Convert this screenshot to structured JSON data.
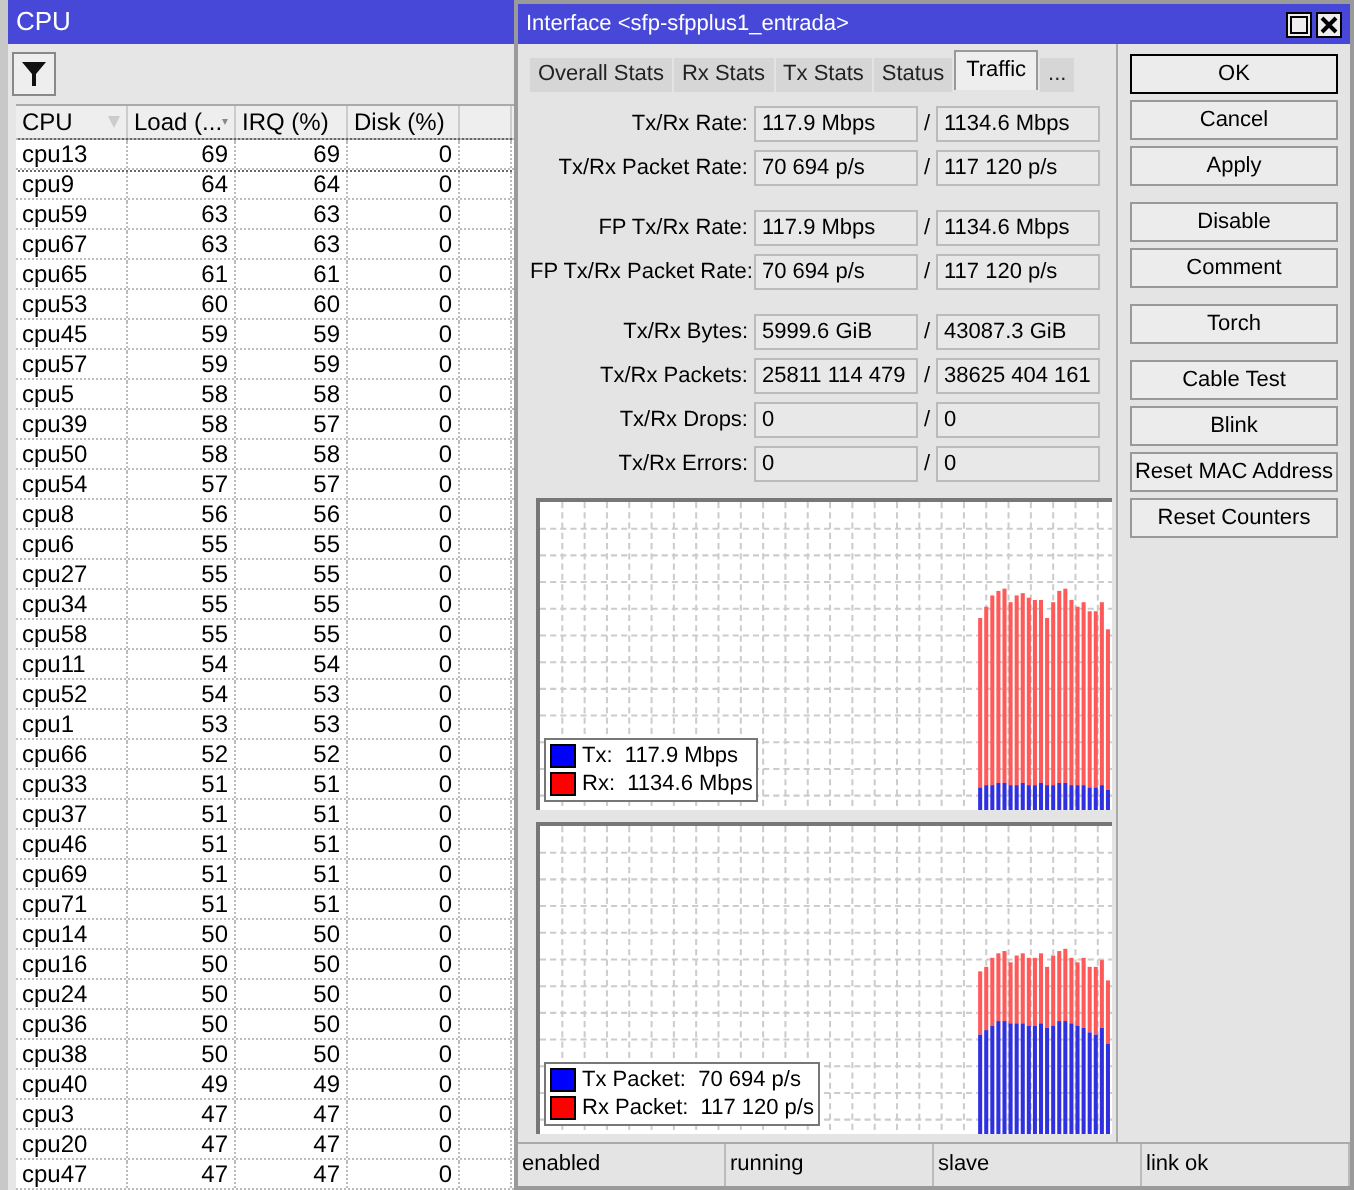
{
  "cpu_window": {
    "title": "CPU",
    "columns": [
      "CPU",
      "Load (...",
      "IRQ (%)",
      "Disk (%)"
    ],
    "rows": [
      [
        "cpu13",
        "69",
        "69",
        "0"
      ],
      [
        "cpu9",
        "64",
        "64",
        "0"
      ],
      [
        "cpu59",
        "63",
        "63",
        "0"
      ],
      [
        "cpu67",
        "63",
        "63",
        "0"
      ],
      [
        "cpu65",
        "61",
        "61",
        "0"
      ],
      [
        "cpu53",
        "60",
        "60",
        "0"
      ],
      [
        "cpu45",
        "59",
        "59",
        "0"
      ],
      [
        "cpu57",
        "59",
        "59",
        "0"
      ],
      [
        "cpu5",
        "58",
        "58",
        "0"
      ],
      [
        "cpu39",
        "58",
        "57",
        "0"
      ],
      [
        "cpu50",
        "58",
        "58",
        "0"
      ],
      [
        "cpu54",
        "57",
        "57",
        "0"
      ],
      [
        "cpu8",
        "56",
        "56",
        "0"
      ],
      [
        "cpu6",
        "55",
        "55",
        "0"
      ],
      [
        "cpu27",
        "55",
        "55",
        "0"
      ],
      [
        "cpu34",
        "55",
        "55",
        "0"
      ],
      [
        "cpu58",
        "55",
        "55",
        "0"
      ],
      [
        "cpu11",
        "54",
        "54",
        "0"
      ],
      [
        "cpu52",
        "54",
        "53",
        "0"
      ],
      [
        "cpu1",
        "53",
        "53",
        "0"
      ],
      [
        "cpu66",
        "52",
        "52",
        "0"
      ],
      [
        "cpu33",
        "51",
        "51",
        "0"
      ],
      [
        "cpu37",
        "51",
        "51",
        "0"
      ],
      [
        "cpu46",
        "51",
        "51",
        "0"
      ],
      [
        "cpu69",
        "51",
        "51",
        "0"
      ],
      [
        "cpu71",
        "51",
        "51",
        "0"
      ],
      [
        "cpu14",
        "50",
        "50",
        "0"
      ],
      [
        "cpu16",
        "50",
        "50",
        "0"
      ],
      [
        "cpu24",
        "50",
        "50",
        "0"
      ],
      [
        "cpu36",
        "50",
        "50",
        "0"
      ],
      [
        "cpu38",
        "50",
        "50",
        "0"
      ],
      [
        "cpu40",
        "49",
        "49",
        "0"
      ],
      [
        "cpu3",
        "47",
        "47",
        "0"
      ],
      [
        "cpu20",
        "47",
        "47",
        "0"
      ],
      [
        "cpu47",
        "47",
        "47",
        "0"
      ]
    ]
  },
  "interface_window": {
    "title": "Interface <sfp-sfpplus1_entrada>",
    "tabs": [
      {
        "label": "Overall Stats",
        "selected": false
      },
      {
        "label": "Rx Stats",
        "selected": false
      },
      {
        "label": "Tx Stats",
        "selected": false
      },
      {
        "label": "Status",
        "selected": false
      },
      {
        "label": "Traffic",
        "selected": true
      },
      {
        "label": "...",
        "selected": false
      }
    ],
    "field_groups": [
      [
        {
          "label": "Tx/Rx Rate:",
          "tx": "117.9 Mbps",
          "rx": "1134.6 Mbps"
        },
        {
          "label": "Tx/Rx Packet Rate:",
          "tx": "70 694 p/s",
          "rx": "117 120 p/s"
        }
      ],
      [
        {
          "label": "FP Tx/Rx Rate:",
          "tx": "117.9 Mbps",
          "rx": "1134.6 Mbps"
        },
        {
          "label": "FP Tx/Rx Packet Rate:",
          "tx": "70 694 p/s",
          "rx": "117 120 p/s"
        }
      ],
      [
        {
          "label": "Tx/Rx Bytes:",
          "tx": "5999.6 GiB",
          "rx": "43087.3 GiB"
        },
        {
          "label": "Tx/Rx Packets:",
          "tx": "25811 114 479",
          "rx": "38625 404 161"
        },
        {
          "label": "Tx/Rx Drops:",
          "tx": "0",
          "rx": "0"
        },
        {
          "label": "Tx/Rx Errors:",
          "tx": "0",
          "rx": "0"
        }
      ]
    ],
    "separator": "/",
    "graphs": [
      {
        "legend": [
          {
            "label": "Tx:  117.9 Mbps",
            "color": "#0000ff"
          },
          {
            "label": "Rx:  1134.6 Mbps",
            "color": "#ff0000"
          }
        ]
      },
      {
        "legend": [
          {
            "label": "Tx Packet:  70 694 p/s",
            "color": "#0000ff"
          },
          {
            "label": "Rx Packet:  117 120 p/s",
            "color": "#ff0000"
          }
        ]
      }
    ],
    "button_groups": [
      [
        "OK",
        "Cancel",
        "Apply"
      ],
      [
        "Disable",
        "Comment"
      ],
      [
        "Torch"
      ],
      [
        "Cable Test",
        "Blink",
        "Reset MAC Address",
        "Reset Counters"
      ]
    ],
    "status_bar": [
      "enabled",
      "running",
      "slave",
      "link ok"
    ]
  }
}
